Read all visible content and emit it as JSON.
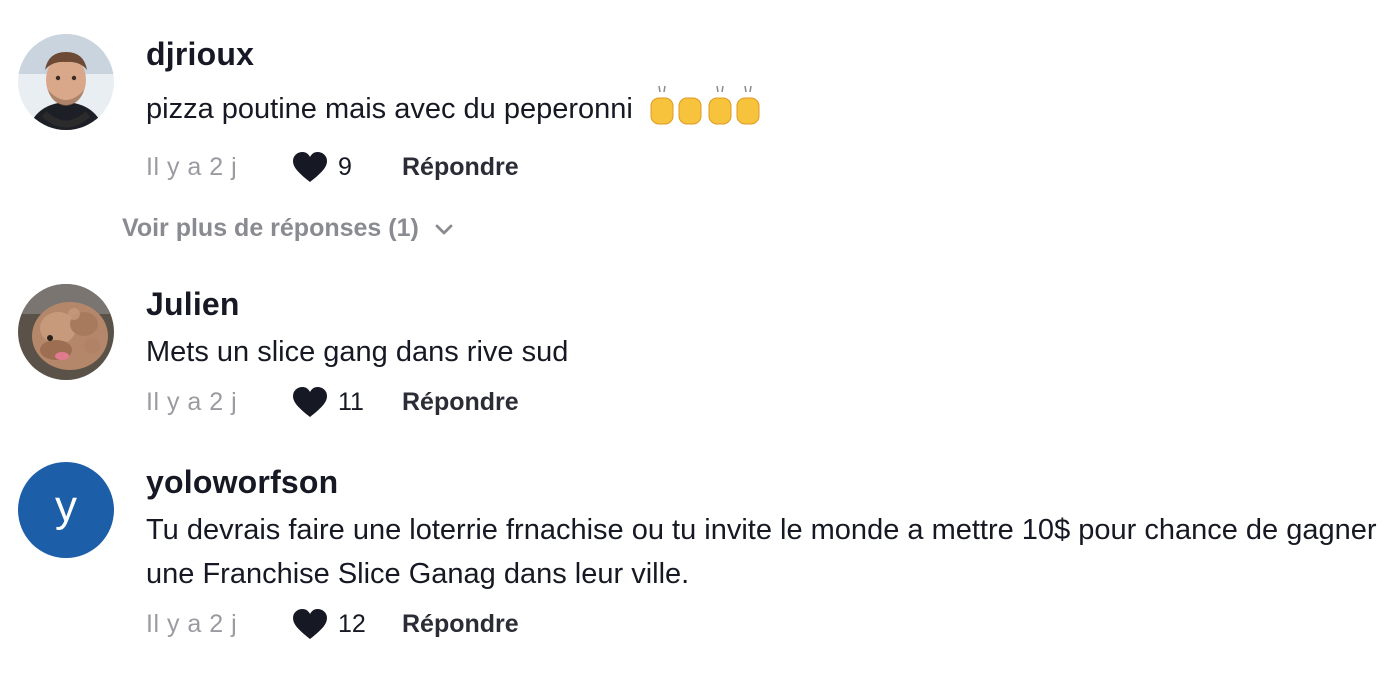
{
  "comments": [
    {
      "username": "djrioux",
      "text": "pizza poutine mais avec du peperonni",
      "emoji_icon": "raising-hands-emoji",
      "time": "Il y a 2 j",
      "likes": "9",
      "reply_label": "Répondre",
      "avatar_icon": "user-photo-avatar"
    },
    {
      "username": "Julien",
      "text": "Mets un slice gang dans rive sud",
      "time": "Il y a 2 j",
      "likes": "11",
      "reply_label": "Répondre",
      "avatar_icon": "dog-photo-avatar"
    },
    {
      "username": "yoloworfson",
      "text": "Tu devrais faire une loterrie frnachise ou tu invite le monde a mettre 10$ pour chance de gagner une Franchise Slice Ganag dans leur ville.",
      "time": "Il y a 2 j",
      "likes": "12",
      "reply_label": "Répondre",
      "avatar_letter": "y",
      "avatar_color": "#1c5ea8"
    }
  ],
  "more_replies": {
    "label": "Voir plus de réponses (1)",
    "icon": "chevron-down-icon"
  },
  "colors": {
    "text": "#161823",
    "muted": "#9a9ba1",
    "heart": "#161823"
  }
}
